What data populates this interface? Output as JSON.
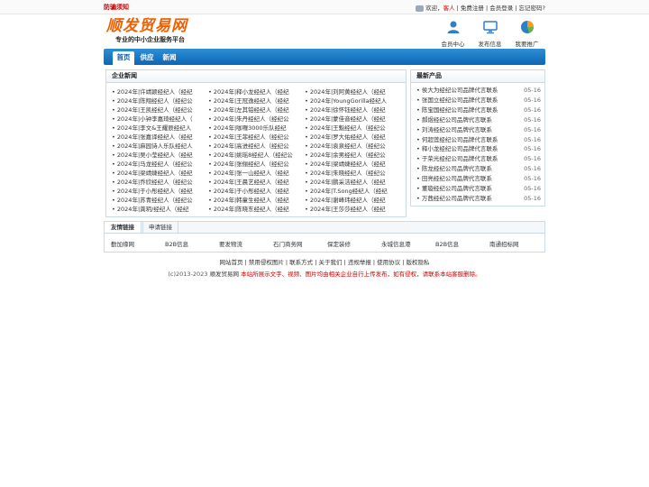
{
  "topbar": {
    "fraud_notice": "防骗须知",
    "welcome": "欢迎，",
    "guest": "客人",
    "register": "免费注册",
    "login": "会员登录",
    "forgot": "忘记密码?",
    "sep": " | "
  },
  "logo": {
    "name": "顺发贸易网",
    "slogan": "专业的中小企业服务平台"
  },
  "header_icons": [
    {
      "label": "会员中心",
      "icon": "member-icon"
    },
    {
      "label": "发布信息",
      "icon": "monitor-icon"
    },
    {
      "label": "我要推广",
      "icon": "promote-icon"
    }
  ],
  "nav": [
    {
      "label": "首页",
      "active": true
    },
    {
      "label": "供应",
      "active": false
    },
    {
      "label": "新闻",
      "active": false
    }
  ],
  "enterprise_news": {
    "title": "企业新闻",
    "columns": [
      [
        "2024年|许靖颖经纪人（经纪",
        "2024年|陈翔经纪人（经纪公",
        "2024年|王凯经纪人（经纪公",
        "2024年|小钟李嘉琦经纪人（",
        "2024年|李文&王耀辰经纪人",
        "2024年|张嘉译经纪人（经纪",
        "2024年|麻园诗人乐队经纪人",
        "2024年|吴小莹经纪人（经纪",
        "2024年|马龙经纪人（经纪公",
        "2024年|梁靖婕经纪人（经纪",
        "2024年|乔欣经纪人（经纪公",
        "2024年|于小彤经纪人（经纪",
        "2024年|苏青经纪人（经纪公",
        "2024年|龚玥/经纪人（经纪"
      ],
      [
        "2024年|释小龙经纪人（经纪",
        "2024年|王冠逸经纪人（经纪",
        "2024年|左其铂经纪人（经纪",
        "2024年|朱丹经纪人（经纪公",
        "2024年|咖喱3000乐队经纪",
        "2024年|王菲经纪人（经纪公",
        "2024年|高进经纪人（经纪公",
        "2024年|姚瑶8经纪人（经纪公",
        "2024年|张俪经纪人（经纪公",
        "2024年|张一山经纪人（经纪",
        "2024年|王晨艺经纪人（经纪",
        "2024年|于小彤经纪人（经纪",
        "2024年|韩童生经纪人（经纪",
        "2024年|陈晓东经纪人（经纪"
      ],
      [
        "2024年|刘阿黄经纪人（经纪",
        "2024年|YoungGorilla经纪人",
        "2024年|徐怀钰经纪人（经纪",
        "2024年|蒙佳音经纪人（经纪",
        "2024年|王魁经纪人（经纪公",
        "2024年|罗大佑经纪人（经纪",
        "2024年|袁泉经纪人（经纪公",
        "2024年|余男经纪人（经纪公",
        "2024年|梁靖婕经纪人（经纪",
        "2024年|朱晓经纪人（经纪公",
        "2024年|鹏采洁经纪人（经纪",
        "2024年|T.Song经纪人（经纪",
        "2024年|谢峰玮经纪人（经纪",
        "2024年|王莎莎经纪人（经纪"
      ]
    ]
  },
  "latest_products": {
    "title": "最新产品",
    "items": [
      {
        "name": "侯大为经纪公司品牌代言联系",
        "date": "05-16"
      },
      {
        "name": "张国立经纪公司品牌代言联系",
        "date": "05-16"
      },
      {
        "name": "陈宝国经纪公司品牌代言联系",
        "date": "05-16"
      },
      {
        "name": "郝煜经纪公司品牌代言联系",
        "date": "05-16"
      },
      {
        "name": "刘涛经纪公司品牌代言联系",
        "date": "05-16"
      },
      {
        "name": "何超莲经纪公司品牌代言联系",
        "date": "05-16"
      },
      {
        "name": "释小龙经纪公司品牌代言联系",
        "date": "05-16"
      },
      {
        "name": "于荣光经纪公司品牌代言联系",
        "date": "05-16"
      },
      {
        "name": "陈龙经纪公司品牌代言联系",
        "date": "05-16"
      },
      {
        "name": "田亮经纪公司品牌代言联系",
        "date": "05-16"
      },
      {
        "name": "董璇经纪公司品牌代言联系",
        "date": "05-16"
      },
      {
        "name": "万茜经纪公司品牌代言联系",
        "date": "05-16"
      }
    ]
  },
  "links": {
    "tab_friend": "友情链接",
    "tab_apply": "申请链接",
    "items": [
      "勤加缘网",
      "B2B信息",
      "要发物流",
      "石门商务网",
      "保定装修",
      "永城信息港",
      "B2B信息",
      "南通招标网"
    ]
  },
  "footer": {
    "links": [
      "网站首页",
      "禁用侵权图片",
      "联系方式",
      "关于我们",
      "违规举报",
      "使用协议",
      "版权隐私"
    ],
    "copyright_prefix": "(c)2013-2023 ",
    "brand": "顺发贸易网",
    "notice": " 本站所展示文字、视频、图片均由相关企业自行上传发布，如有侵权，请联系本站客服删除。"
  },
  "colors": {
    "nav_blue": "#0d66b3",
    "accent_red": "#cc0000",
    "logo_orange": "#f06000"
  }
}
